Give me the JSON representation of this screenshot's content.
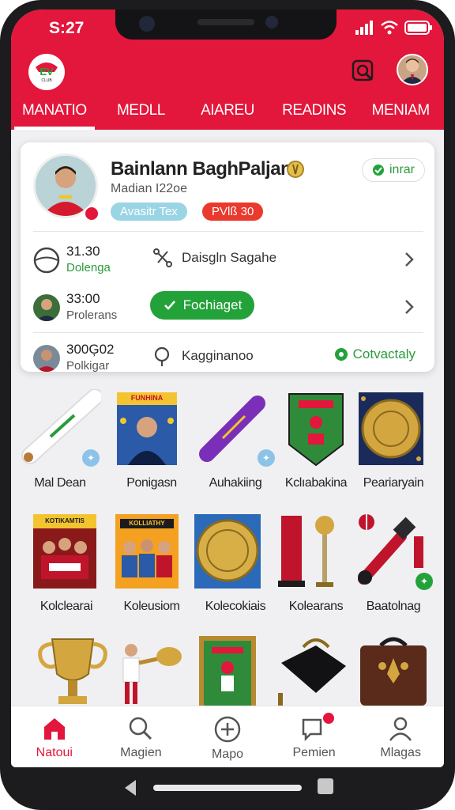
{
  "status": {
    "time": "S:27"
  },
  "header": {
    "logo_text": "CLUB",
    "tabs": [
      {
        "label": "MANATIO",
        "active": true
      },
      {
        "label": "MEDLL",
        "active": false
      },
      {
        "label": "AIAREU",
        "active": false
      },
      {
        "label": "READINS",
        "active": false
      },
      {
        "label": "MENIAM",
        "active": false
      }
    ]
  },
  "profile": {
    "name": "Bainlann BaghPaljan",
    "subtitle": "Madian I22oe",
    "badge_primary": "Avasitr Tex",
    "badge_secondary": "PVlß 30",
    "follow_label": "inrar"
  },
  "stats": [
    {
      "value": "31.30",
      "label": "Dolenga",
      "label_color": "#2a9b3a",
      "action": "Daisgln Sagahe"
    },
    {
      "value": "33:00",
      "label": "Prolerans",
      "label_color": "#555555",
      "action": "Fochiaget"
    },
    {
      "value": "300Ģ02",
      "label": "Polkigar",
      "label_color": "#555555",
      "action": "Kagginanoo",
      "extra": "Cotvactaly"
    }
  ],
  "items_row1": [
    {
      "caption": "Mal Dean"
    },
    {
      "caption": "Ponigasn",
      "poster_text": "FUNHINA"
    },
    {
      "caption": "Auhakiing"
    },
    {
      "caption": "Kclıabakina"
    },
    {
      "caption": "Peariaryain"
    }
  ],
  "items_row2": [
    {
      "caption": "Kolclearai",
      "poster_text": "KOTIKAMTIS"
    },
    {
      "caption": "Koleusiom",
      "poster_text": "KOLLIATHY"
    },
    {
      "caption": "Kolecokiais"
    },
    {
      "caption": "Kolearans"
    },
    {
      "caption": "Baatolnag"
    }
  ],
  "nav": [
    {
      "label": "Natoui",
      "active": true
    },
    {
      "label": "Magien",
      "active": false
    },
    {
      "label": "Mapo",
      "active": false
    },
    {
      "label": "Pemien",
      "active": false
    },
    {
      "label": "Mlagas",
      "active": false
    }
  ],
  "colors": {
    "brand": "#e3163b",
    "green": "#23a23a"
  }
}
